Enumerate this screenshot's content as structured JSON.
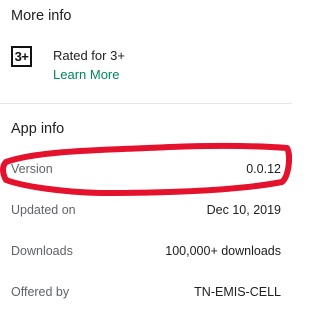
{
  "more_info": {
    "title": "More info",
    "rating_badge": "3+",
    "rating_text": "Rated for 3+",
    "learn_more": "Learn More"
  },
  "app_info": {
    "title": "App info",
    "rows": [
      {
        "label": "Version",
        "value": "0.0.12"
      },
      {
        "label": "Updated on",
        "value": "Dec 10, 2019"
      },
      {
        "label": "Downloads",
        "value": "100,000+ downloads"
      },
      {
        "label": "Offered by",
        "value": "TN-EMIS-CELL"
      }
    ]
  },
  "colors": {
    "link": "#01875f",
    "annotation_stroke": "#e5122d"
  }
}
